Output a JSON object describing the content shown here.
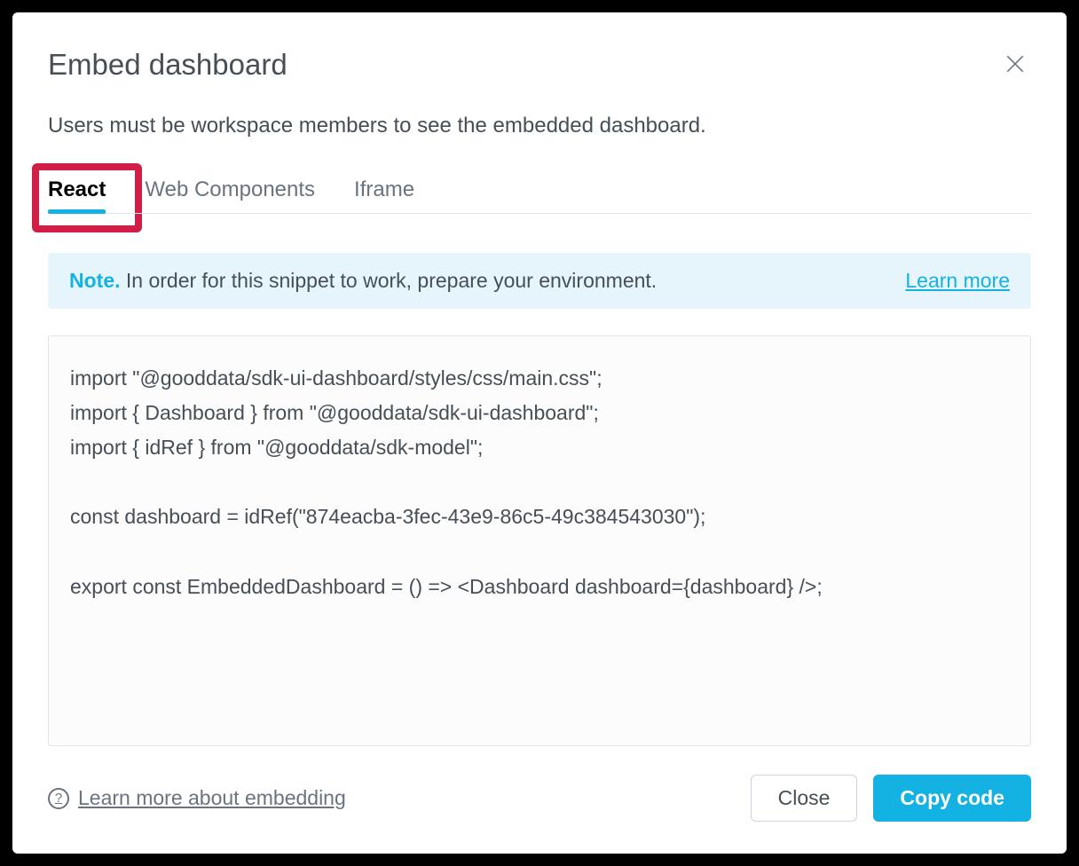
{
  "dialog": {
    "title": "Embed dashboard",
    "subtitle": "Users must be workspace members to see the embedded dashboard."
  },
  "tabs": {
    "items": [
      {
        "label": "React",
        "active": true
      },
      {
        "label": "Web Components",
        "active": false
      },
      {
        "label": "Iframe",
        "active": false
      }
    ]
  },
  "note": {
    "prefix": "Note.",
    "text": " In order for this snippet to work, prepare your environment.",
    "learn_more": "Learn more"
  },
  "code": "import \"@gooddata/sdk-ui-dashboard/styles/css/main.css\";\nimport { Dashboard } from \"@gooddata/sdk-ui-dashboard\";\nimport { idRef } from \"@gooddata/sdk-model\";\n\nconst dashboard = idRef(\"874eacba-3fec-43e9-86c5-49c384543030\");\n\nexport const EmbeddedDashboard = () => <Dashboard dashboard={dashboard} />;",
  "footer": {
    "learn_link": "Learn more about embedding",
    "close_label": "Close",
    "copy_label": "Copy code"
  }
}
